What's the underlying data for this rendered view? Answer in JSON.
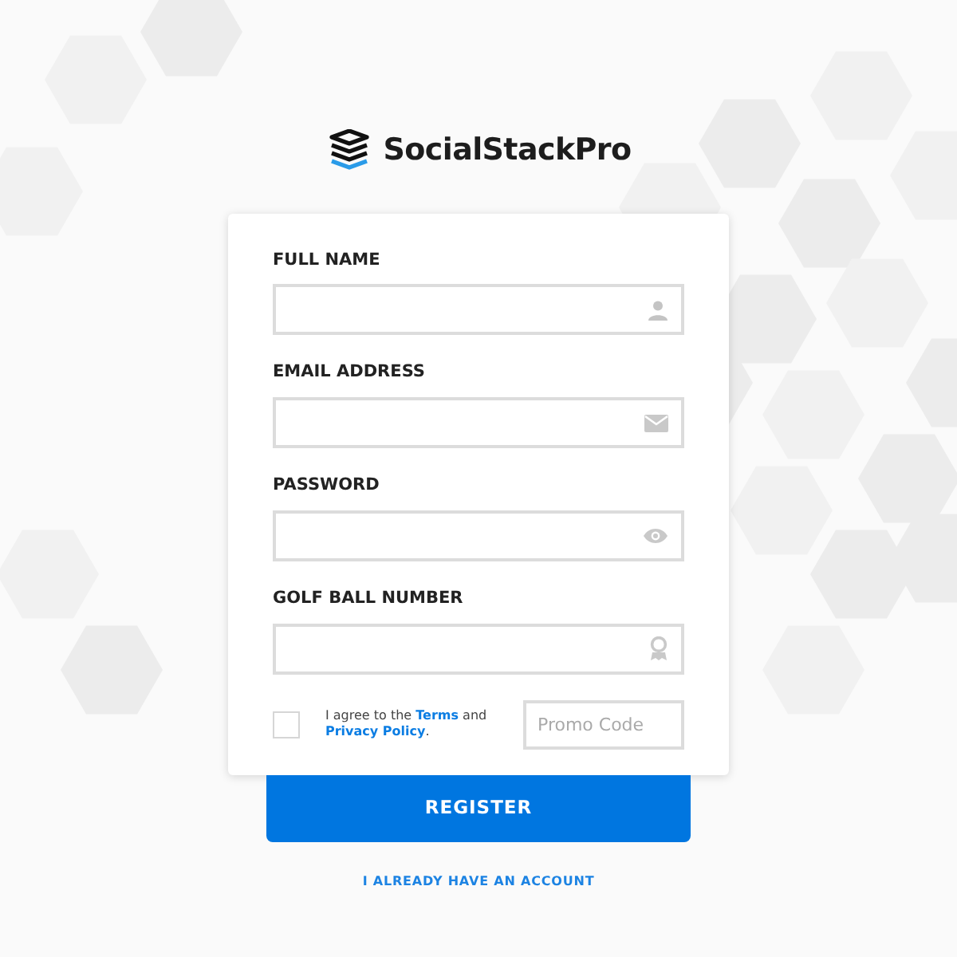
{
  "brand": {
    "name": "SocialStackPro"
  },
  "fields": [
    {
      "label": "FULL NAME",
      "kind": "name"
    },
    {
      "label": "EMAIL ADDRESS",
      "kind": "email"
    },
    {
      "label": "PASSWORD",
      "kind": "password"
    },
    {
      "label": "GOLF BALL NUMBER",
      "kind": "number"
    }
  ],
  "agreement": {
    "checked": false,
    "before": "I agree to the",
    "terms": "Terms",
    "middle": "and",
    "privacy": "Privacy Policy",
    "after": "."
  },
  "promo": {
    "placeholder": "Promo Code"
  },
  "register_button": "REGISTER",
  "login_link": "I ALREADY HAVE AN ACCOUNT"
}
